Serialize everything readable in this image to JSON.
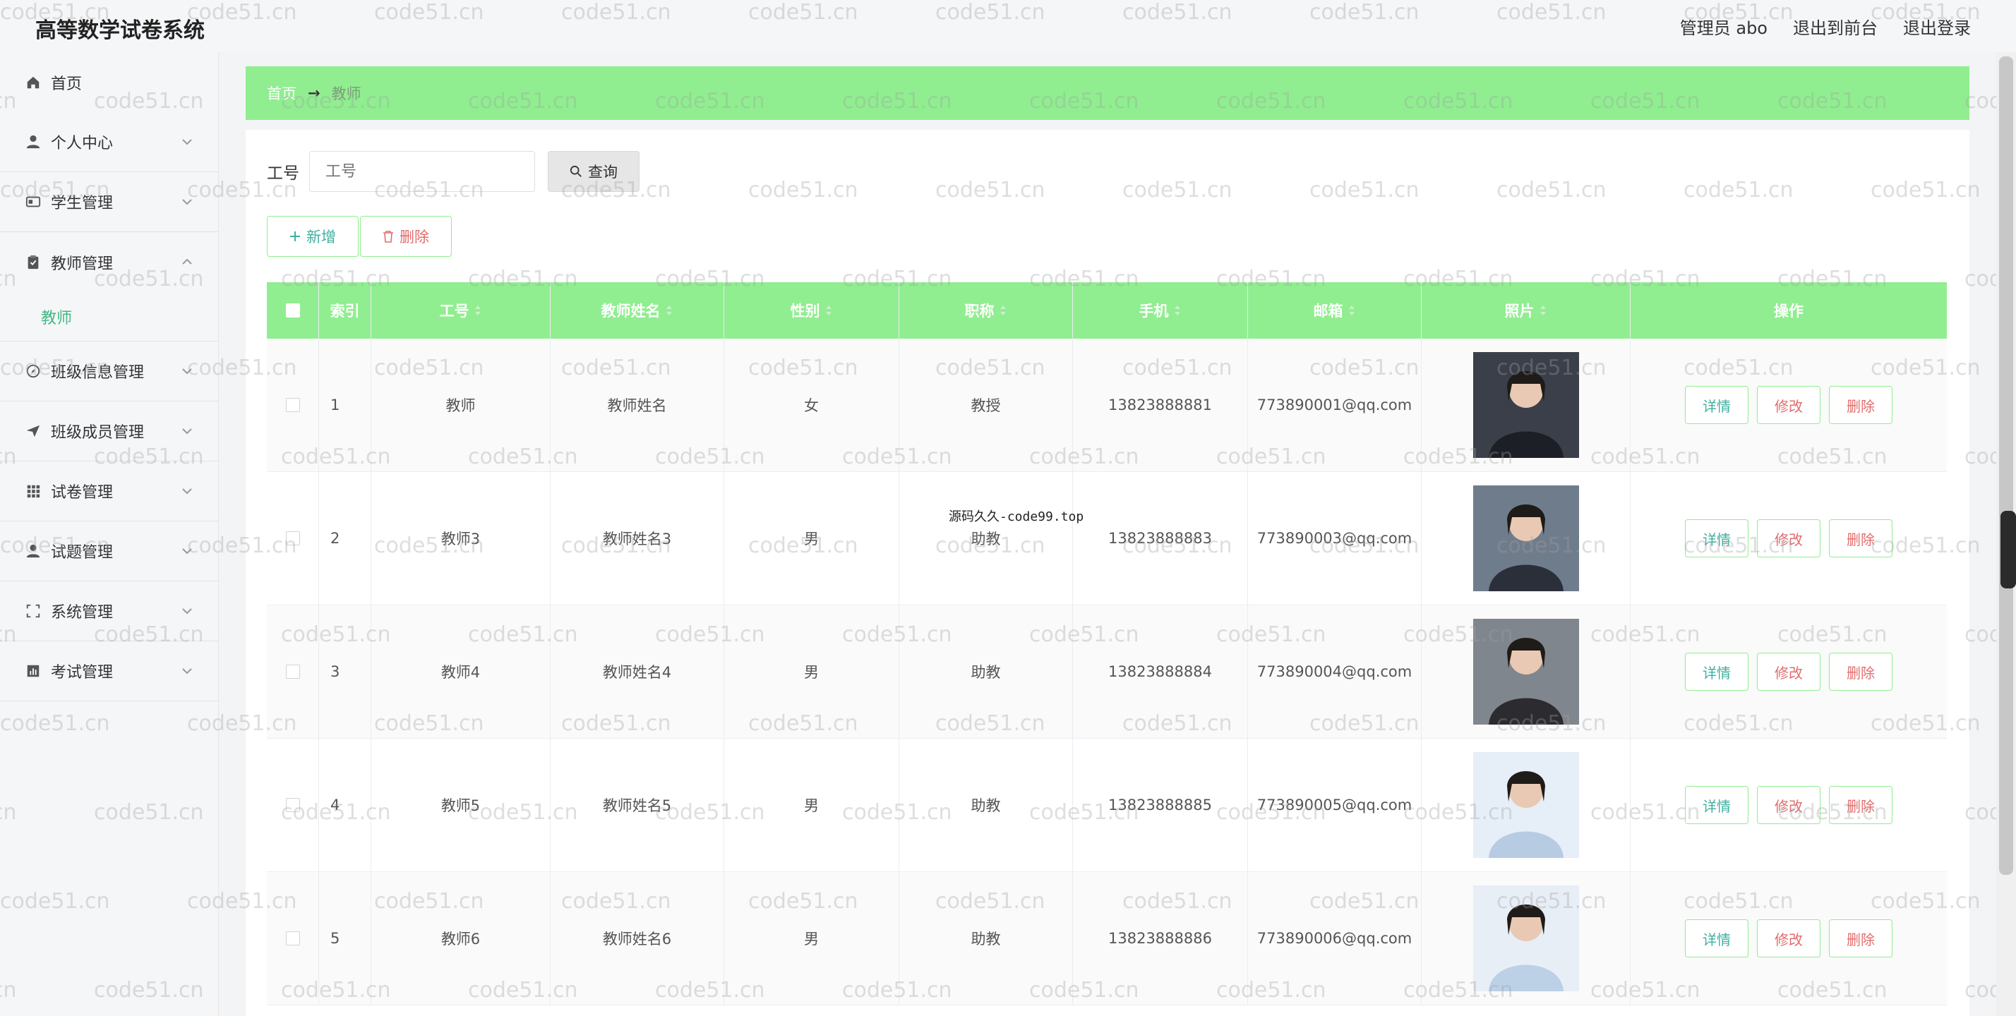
{
  "header": {
    "title": "高等数学试卷系统",
    "links": [
      "管理员 abo",
      "退出到前台",
      "退出登录"
    ]
  },
  "sidebar": {
    "items": [
      {
        "label": "首页",
        "icon": "home-icon"
      },
      {
        "label": "个人中心",
        "icon": "user-icon"
      },
      {
        "label": "学生管理",
        "icon": "id-card-icon"
      },
      {
        "label": "教师管理",
        "icon": "clipboard-icon"
      },
      {
        "label": "班级信息管理",
        "icon": "compass-icon"
      },
      {
        "label": "班级成员管理",
        "icon": "paper-plane-icon"
      },
      {
        "label": "试卷管理",
        "icon": "grid-icon"
      },
      {
        "label": "试题管理",
        "icon": "user-tie-icon"
      },
      {
        "label": "系统管理",
        "icon": "frame-icon"
      },
      {
        "label": "考试管理",
        "icon": "chart-icon"
      }
    ],
    "submenu": {
      "label": "教师"
    }
  },
  "breadcrumb": {
    "home": "首页",
    "separator": "→",
    "current": "教师"
  },
  "search": {
    "label": "工号",
    "placeholder": "工号",
    "button": "查询"
  },
  "actions": {
    "add": "新增",
    "delete": "删除"
  },
  "table": {
    "headers": [
      "索引",
      "工号",
      "教师姓名",
      "性别",
      "职称",
      "手机",
      "邮箱",
      "照片",
      "操作"
    ],
    "rows": [
      {
        "index": "1",
        "id": "教师",
        "name": "教师姓名",
        "gender": "女",
        "title": "教授",
        "phone": "13823888881",
        "email": "773890001@qq.com"
      },
      {
        "index": "2",
        "id": "教师3",
        "name": "教师姓名3",
        "gender": "男",
        "title": "助教",
        "phone": "13823888883",
        "email": "773890003@qq.com"
      },
      {
        "index": "3",
        "id": "教师4",
        "name": "教师姓名4",
        "gender": "男",
        "title": "助教",
        "phone": "13823888884",
        "email": "773890004@qq.com"
      },
      {
        "index": "4",
        "id": "教师5",
        "name": "教师姓名5",
        "gender": "男",
        "title": "助教",
        "phone": "13823888885",
        "email": "773890005@qq.com"
      },
      {
        "index": "5",
        "id": "教师6",
        "name": "教师姓名6",
        "gender": "男",
        "title": "助教",
        "phone": "13823888886",
        "email": "773890006@qq.com"
      }
    ],
    "ops": {
      "detail": "详情",
      "edit": "修改",
      "delete": "删除"
    }
  },
  "watermark": "code51.cn",
  "center_note": "源码久久-code99.top"
}
